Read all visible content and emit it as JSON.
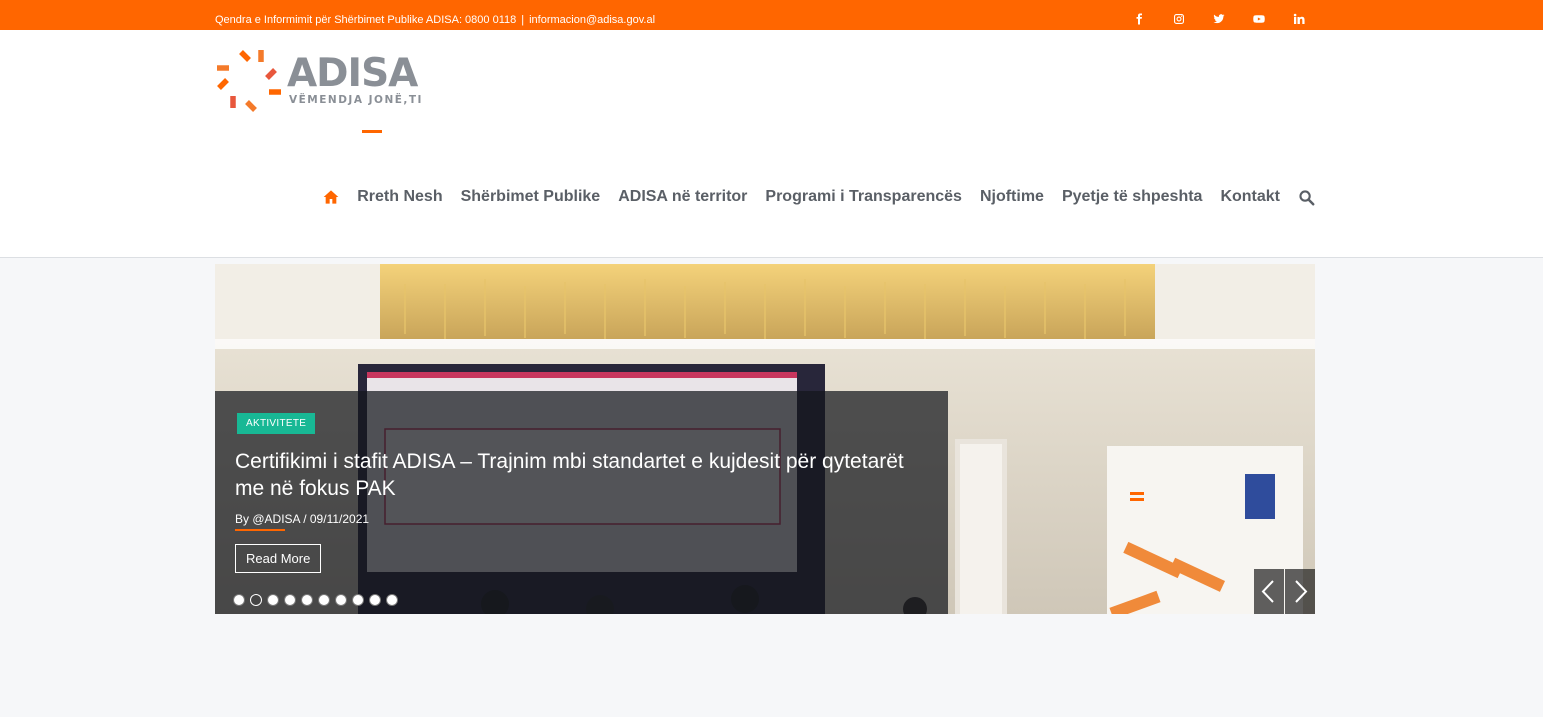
{
  "topbar": {
    "info_text": "Qendra e Informimit për Shërbimet Publike ADISA: 0800 0118",
    "separator": "|",
    "email": "informacion@adisa.gov.al",
    "social_icons": [
      "facebook-icon",
      "instagram-icon",
      "twitter-icon",
      "youtube-icon",
      "linkedin-icon"
    ]
  },
  "logo": {
    "word": "ADISA",
    "tagline": "VËMENDJA JONË,TI"
  },
  "nav": {
    "items": [
      {
        "label": "Rreth Nesh"
      },
      {
        "label": "Shërbimet Publike"
      },
      {
        "label": "ADISA në territor"
      },
      {
        "label": "Programi i Transparencës"
      },
      {
        "label": "Njoftime"
      },
      {
        "label": "Pyetje të shpeshta"
      },
      {
        "label": "Kontakt"
      }
    ]
  },
  "slider": {
    "category": "AKTIVITETE",
    "title": "Certifikimi i stafit ADISA – Trajnim mbi standartet e kujdesit për qytetarët me në fokus PAK",
    "author": "By @ADISA",
    "date": "/ 09/11/2021",
    "read_more": "Read More",
    "slide_count": 10,
    "active_slide": 2
  },
  "colors": {
    "brand": "#ff6600",
    "badge": "#18b895",
    "nav_text": "#5a5f66"
  }
}
